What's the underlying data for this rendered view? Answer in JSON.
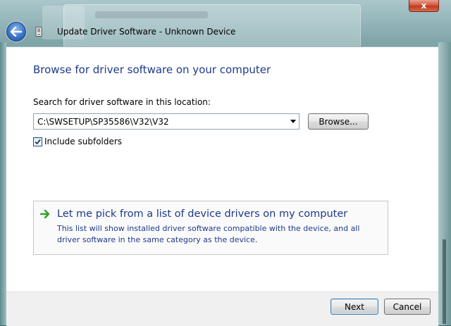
{
  "window": {
    "title": "Update Driver Software - Unknown Device",
    "close_label": "x"
  },
  "page": {
    "heading": "Browse for driver software on your computer",
    "search_label": "Search for driver software in this location:",
    "path_value": "C:\\SWSETUP\\SP35586\\V32\\V32",
    "browse_label": "Browse...",
    "include_subfolders_label": "Include subfolders",
    "include_subfolders_checked": true
  },
  "pick": {
    "title": "Let me pick from a list of device drivers on my computer",
    "description": "This list will show installed driver software compatible with the device, and all driver software in the same category as the device."
  },
  "footer": {
    "next_label": "Next",
    "cancel_label": "Cancel"
  },
  "colors": {
    "heading": "#1e3a8a",
    "pick_arrow": "#2fa12f",
    "close_button": "#c4391d"
  },
  "icons": {
    "back": "back-arrow-icon",
    "device": "device-icon",
    "dropdown": "chevron-down-icon",
    "check": "checkmark-icon",
    "pick": "green-arrow-icon"
  }
}
